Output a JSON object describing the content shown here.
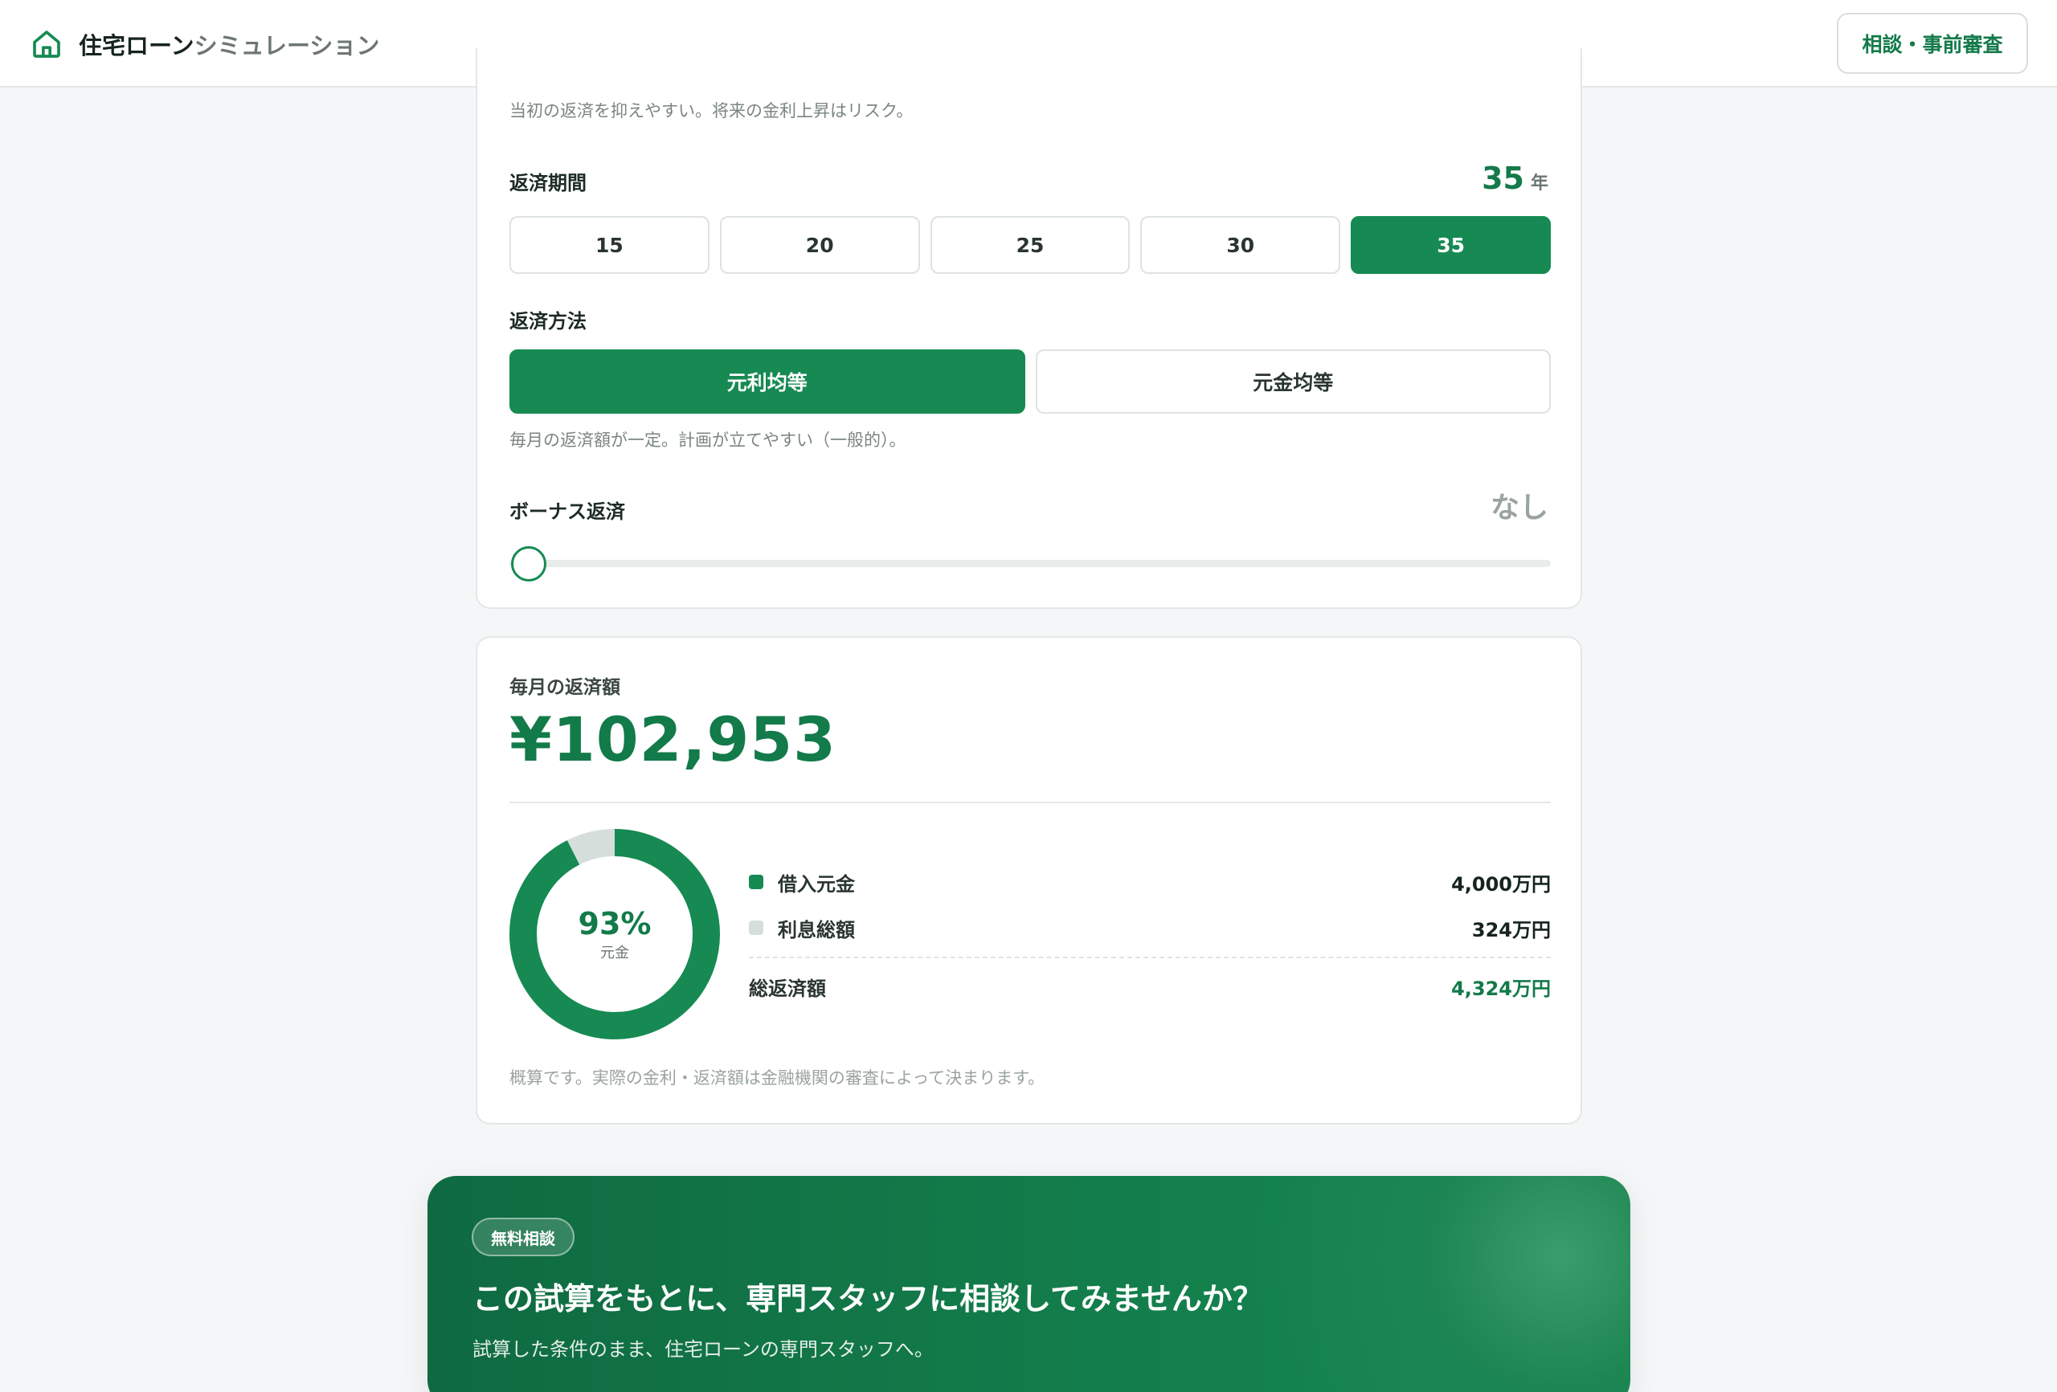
{
  "header": {
    "app_title_main": "住宅ローン",
    "app_title_sub": "シミュレーション",
    "home_icon": "home-icon",
    "consult_button": "相談・事前審査"
  },
  "rate_section": {
    "note": "当初の返済を抑えやすい。将来の金利上昇はリスク。"
  },
  "period": {
    "label": "返済期間",
    "value": "35",
    "unit": "年",
    "options": [
      "15",
      "20",
      "25",
      "30",
      "35"
    ],
    "selected": "35"
  },
  "method": {
    "label": "返済方法",
    "options": [
      "元利均等",
      "元金均等"
    ],
    "selected": "元利均等",
    "note": "毎月の返済額が一定。計画が立てやすい（一般的）。"
  },
  "bonus": {
    "label": "ボーナス返済",
    "value": "なし",
    "slider_fraction": 0
  },
  "result": {
    "label": "毎月の返済額",
    "amount": "¥102,953",
    "donut_percent": "93%",
    "donut_label": "元金",
    "principal_fraction": 0.925,
    "legend": [
      {
        "name": "借入元金",
        "value": "4,000万円",
        "color": "#168a52"
      },
      {
        "name": "利息総額",
        "value": "324万円",
        "color": "#d6dedb"
      }
    ],
    "total_label": "総返済額",
    "total_value": "4,324万円",
    "disclaimer": "概算です。実際の金利・返済額は金融機関の審査によって決まります。"
  },
  "cta": {
    "badge": "無料相談",
    "title": "この試算をもとに、専門スタッフに相談してみませんか？",
    "subtitle": "試算した条件のまま、住宅ローンの専門スタッフへ。"
  },
  "colors": {
    "accent": "#168a52",
    "accent_dark": "#137a4a",
    "interest": "#d6dedb"
  }
}
